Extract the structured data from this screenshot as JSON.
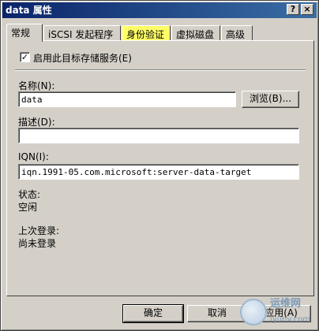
{
  "window": {
    "title": "data 属性",
    "help_glyph": "?",
    "close_glyph": "×"
  },
  "tabs": [
    {
      "label": "常规",
      "active": true
    },
    {
      "label": "iSCSI 发起程序",
      "active": false
    },
    {
      "label": "身份验证",
      "active": false,
      "highlighted": true
    },
    {
      "label": "虚拟磁盘",
      "active": false
    },
    {
      "label": "高级",
      "active": false
    }
  ],
  "general": {
    "enable_checkbox": {
      "label": "启用此目标存储服务(E)",
      "checked": true,
      "glyph": "✓"
    },
    "name": {
      "label": "名称(N):",
      "value": "data",
      "browse_label": "浏览(B)..."
    },
    "description": {
      "label": "描述(D):",
      "value": ""
    },
    "iqn": {
      "label": "IQN(I):",
      "value": "iqn.1991-05.com.microsoft:server-data-target"
    },
    "status": {
      "label": "状态:",
      "value": "空闲"
    },
    "last_login": {
      "label": "上次登录:",
      "value": "尚未登录"
    }
  },
  "footer": {
    "ok_label": "确定",
    "cancel_label": "取消",
    "apply_label": "应用(A)"
  },
  "watermark": {
    "line1": "运维网",
    "line2": "iyunv.com"
  },
  "colors": {
    "title_start": "#0a246a",
    "title_end": "#3a6ea5",
    "face": "#d4d0c8",
    "tab_highlight": "#ffff66"
  }
}
